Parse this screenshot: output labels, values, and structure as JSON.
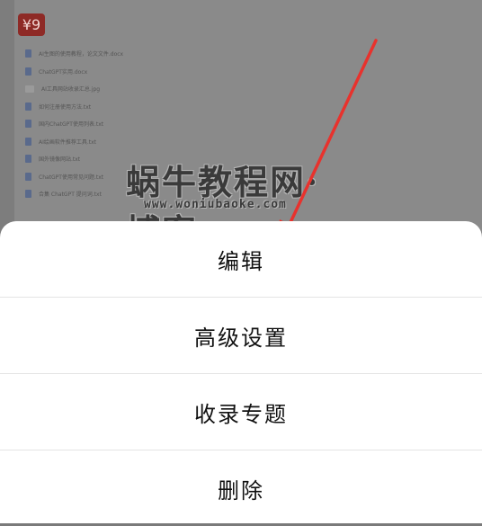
{
  "background": {
    "app_badge": "¥9",
    "files": [
      {
        "name": "AI生图的使用教程，论文文件.docx",
        "type": "doc"
      },
      {
        "name": "ChatGPT实用.docx",
        "type": "doc"
      },
      {
        "name": "AI工具网站收录汇总.jpg",
        "type": "img"
      },
      {
        "name": "如何注册使用方法.txt",
        "type": "doc"
      },
      {
        "name": "国内ChatGPT使用列表.txt",
        "type": "doc"
      },
      {
        "name": "AI绘画软件推荐工具.txt",
        "type": "doc"
      },
      {
        "name": "国外镜像网站.txt",
        "type": "doc"
      },
      {
        "name": "ChatGPT使用常见问题.txt",
        "type": "doc"
      },
      {
        "name": "合集 ChatGPT 提问词.txt",
        "type": "doc"
      }
    ],
    "watermark": {
      "title": "蜗牛教程网·博客",
      "url": "www.woniubaoke.com"
    }
  },
  "sheet": {
    "items": [
      {
        "label": "编辑"
      },
      {
        "label": "高级设置"
      },
      {
        "label": "收录专题"
      },
      {
        "label": "删除"
      }
    ]
  },
  "colors": {
    "overlay": "#7d7d7d",
    "arrow": "#e8322d",
    "sheet_bg": "#ffffff",
    "divider": "#e4e4e4"
  }
}
